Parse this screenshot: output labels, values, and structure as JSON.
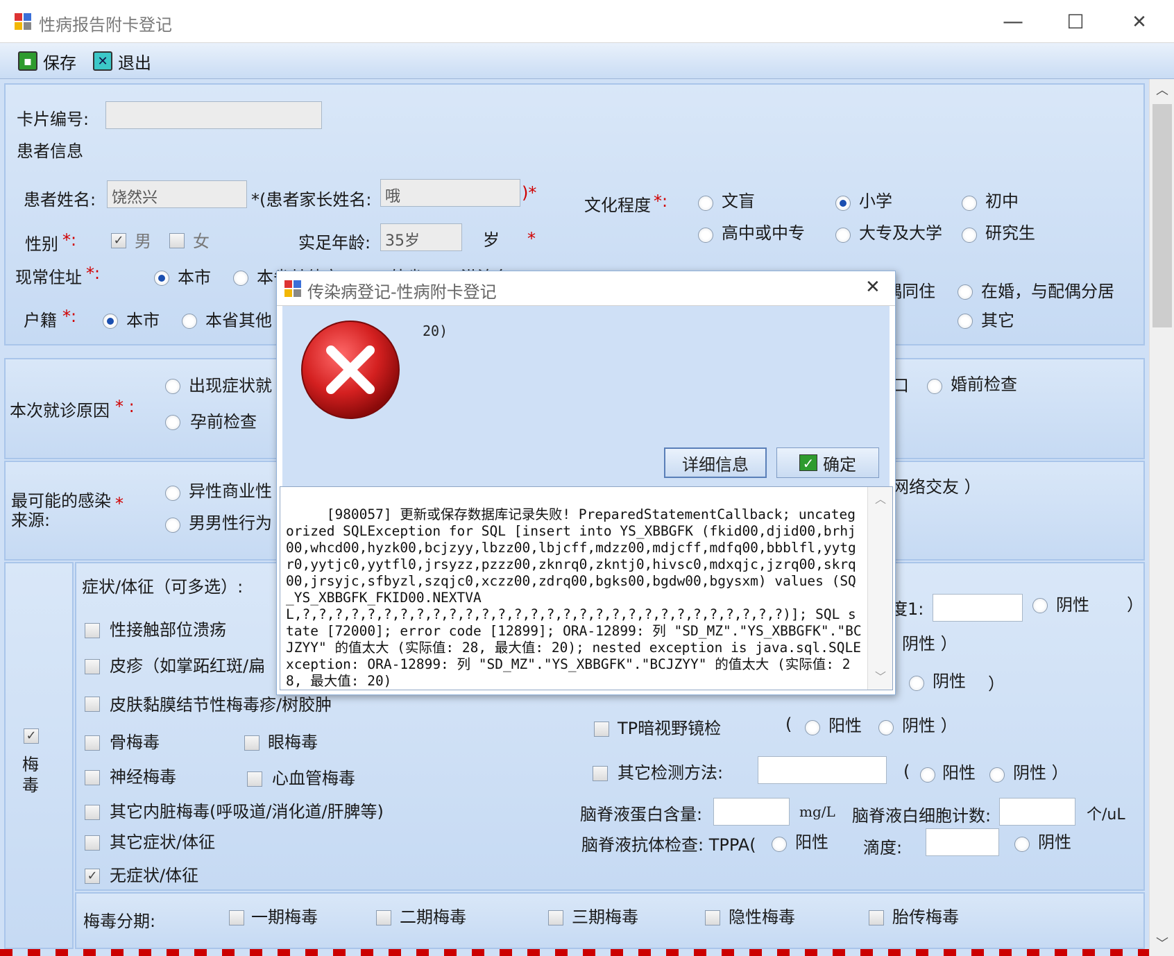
{
  "window": {
    "title": "性病报告附卡登记",
    "minimize": "—",
    "maximize": "☐",
    "close": "✕"
  },
  "toolbar": {
    "save_label": "保存",
    "exit_label": "退出"
  },
  "card": {
    "number_label": "卡片编号:",
    "number_value": ""
  },
  "patient": {
    "section_title": "患者信息",
    "name_label": "患者姓名:",
    "name_value": "饶然兴",
    "parent_label": "*(患者家长姓名:",
    "parent_value": "哦",
    "parent_close": ")*",
    "gender_label": "性别",
    "gender_male": "男",
    "gender_female": "女",
    "age_label": "实足年龄:",
    "age_value": "35岁",
    "age_unit": "岁",
    "address_label": "现常住址",
    "address_opt1": "本市",
    "address_opt2_partial": "本省其他市",
    "address_opt3_partial": "外省",
    "address_opt4_partial": "港澳台",
    "huji_label": "户籍",
    "huji_opt1": "本市",
    "huji_opt2_partial": "本省其他",
    "education_label": "文化程度",
    "edu_opts": [
      "文盲",
      "小学",
      "初中",
      "高中或中专",
      "大专及大学",
      "研究生"
    ],
    "marriage_partial": "偶同住",
    "marriage_opt": "在婚，与配偶分居",
    "marriage_other": "其它"
  },
  "visit": {
    "label": "本次就诊原因",
    "opt1_partial": "出现症状就",
    "opt2": "孕前检查",
    "opt3": "婚前检查",
    "opt_partial_right": "口"
  },
  "infection": {
    "label_line1": "最可能的感染",
    "label_line2": "来源:",
    "opt1_partial": "异性商业性",
    "opt2_partial": "男男性行为",
    "right_partial": "网络交友 ）"
  },
  "syphilis": {
    "side_label_1": "梅",
    "side_label_2": "毒",
    "symptoms_label": "症状/体征（可多选）:",
    "s1": "性接触部位溃疡",
    "s2": "皮疹（如掌跖红斑/扁",
    "s3": "皮肤黏膜结节性梅毒疹/树胶肿",
    "s4": "骨梅毒",
    "s5": "眼梅毒",
    "s6": "神经梅毒",
    "s7": "心血管梅毒",
    "s8": "其它内脏梅毒(呼吸道/消化道/肝脾等)",
    "s9": "其它症状/体征",
    "s10": "无症状/体征",
    "r_test1_partial": "度1:",
    "neg": "阴性",
    "neg_paren": "阴性 ）",
    "pos": "阳性",
    "paren_close": "）",
    "paren_open": "(",
    "tp_label": "TP暗视野镜检",
    "other_test_label": "其它检测方法:",
    "csf_protein_label": "脑脊液蛋白含量:",
    "csf_protein_unit": "mg/L",
    "csf_wbc_label": "脑脊液白细胞计数:",
    "csf_wbc_unit": "个/uL",
    "csf_antibody_label": "脑脊液抗体检查: TPPA(",
    "titer_label": "滴度:"
  },
  "staging": {
    "label": "梅毒分期:",
    "opts": [
      "一期梅毒",
      "二期梅毒",
      "三期梅毒",
      "隐性梅毒",
      "胎传梅毒"
    ]
  },
  "dialog": {
    "title": "传染病登记-性病附卡登记",
    "close": "✕",
    "message_tail": "20)",
    "details_button": "详细信息",
    "ok_button": "确定",
    "detail_text": " [980057] 更新或保存数据库记录失败! PreparedStatementCallback; uncategorized SQLException for SQL [insert into YS_XBBGFK (fkid00,djid00,brhj00,whcd00,hyzk00,bcjzyy,lbzz00,lbjcff,mdzz00,mdjcff,mdfq00,bbblfl,yytgr0,yytjc0,yytfl0,jrsyzz,pzzz00,zknrq0,zkntj0,hivsc0,mdxqjc,jzrq00,skrq00,jrsyjc,sfbyzl,szqjc0,xczz00,zdrq00,bgks00,bgdw00,bgysxm) values (SQ_YS_XBBGFK_FKID00.NEXTVAL,?,?,?,?,?,?,?,?,?,?,?,?,?,?,?,?,?,?,?,?,?,?,?,?,?,?,?,?,?,?)]; SQL state [72000]; error code [12899]; ORA-12899: 列 \"SD_MZ\".\"YS_XBBGFK\".\"BCJZYY\" 的值太大 (实际值: 28, 最大值: 20); nested exception is java.sql.SQLException: ORA-12899: 列 \"SD_MZ\".\"YS_XBBGFK\".\"BCJZYY\" 的值太大 (实际值: 28, 最大值: 20)"
  },
  "colors": {
    "accent": "#1b4fb0",
    "required": "#d00000",
    "panel_bg": "#cfe0f6",
    "error_red": "#d42020"
  }
}
